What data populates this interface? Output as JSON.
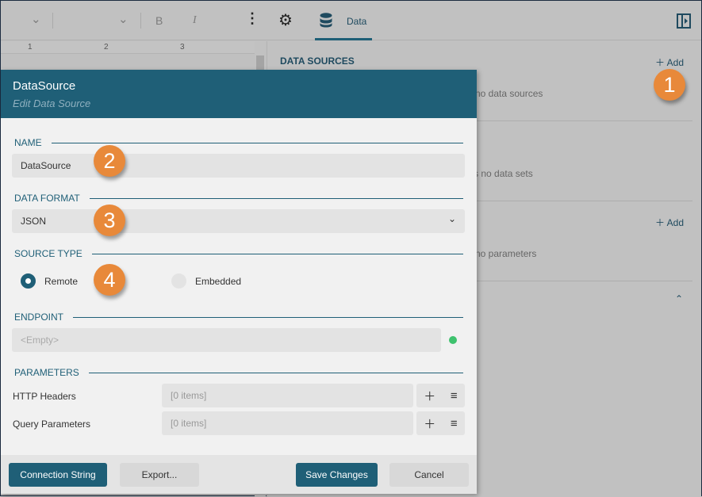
{
  "toolbar": {
    "bold": "B",
    "italic": "I",
    "data_tab": "Data"
  },
  "ruler": [
    "1",
    "2",
    "3"
  ],
  "right_panel": {
    "data_sources_title": "DATA SOURCES",
    "add": "Add",
    "data_sources_msg": "no data sources",
    "data_sets_msg": "s no data sets",
    "parameters_add": "Add",
    "parameters_msg": "no parameters"
  },
  "badges": [
    "1",
    "2",
    "3",
    "4"
  ],
  "dialog": {
    "title": "DataSource",
    "subtitle": "Edit Data Source",
    "name_label": "NAME",
    "name_value": "DataSource",
    "format_label": "DATA FORMAT",
    "format_value": "JSON",
    "source_type_label": "SOURCE TYPE",
    "remote": "Remote",
    "embedded": "Embedded",
    "source_type_selected": "Remote",
    "endpoint_label": "ENDPOINT",
    "endpoint_placeholder": "<Empty>",
    "endpoint_status_color": "#3ec26e",
    "parameters_label": "PARAMETERS",
    "params": [
      {
        "label": "HTTP Headers",
        "value": "[0 items]"
      },
      {
        "label": "Query Parameters",
        "value": "[0 items]"
      }
    ],
    "buttons": {
      "connection": "Connection String",
      "export": "Export...",
      "save": "Save Changes",
      "cancel": "Cancel"
    }
  },
  "colors": {
    "accent": "#1f5f77",
    "badge": "#e8893a"
  }
}
